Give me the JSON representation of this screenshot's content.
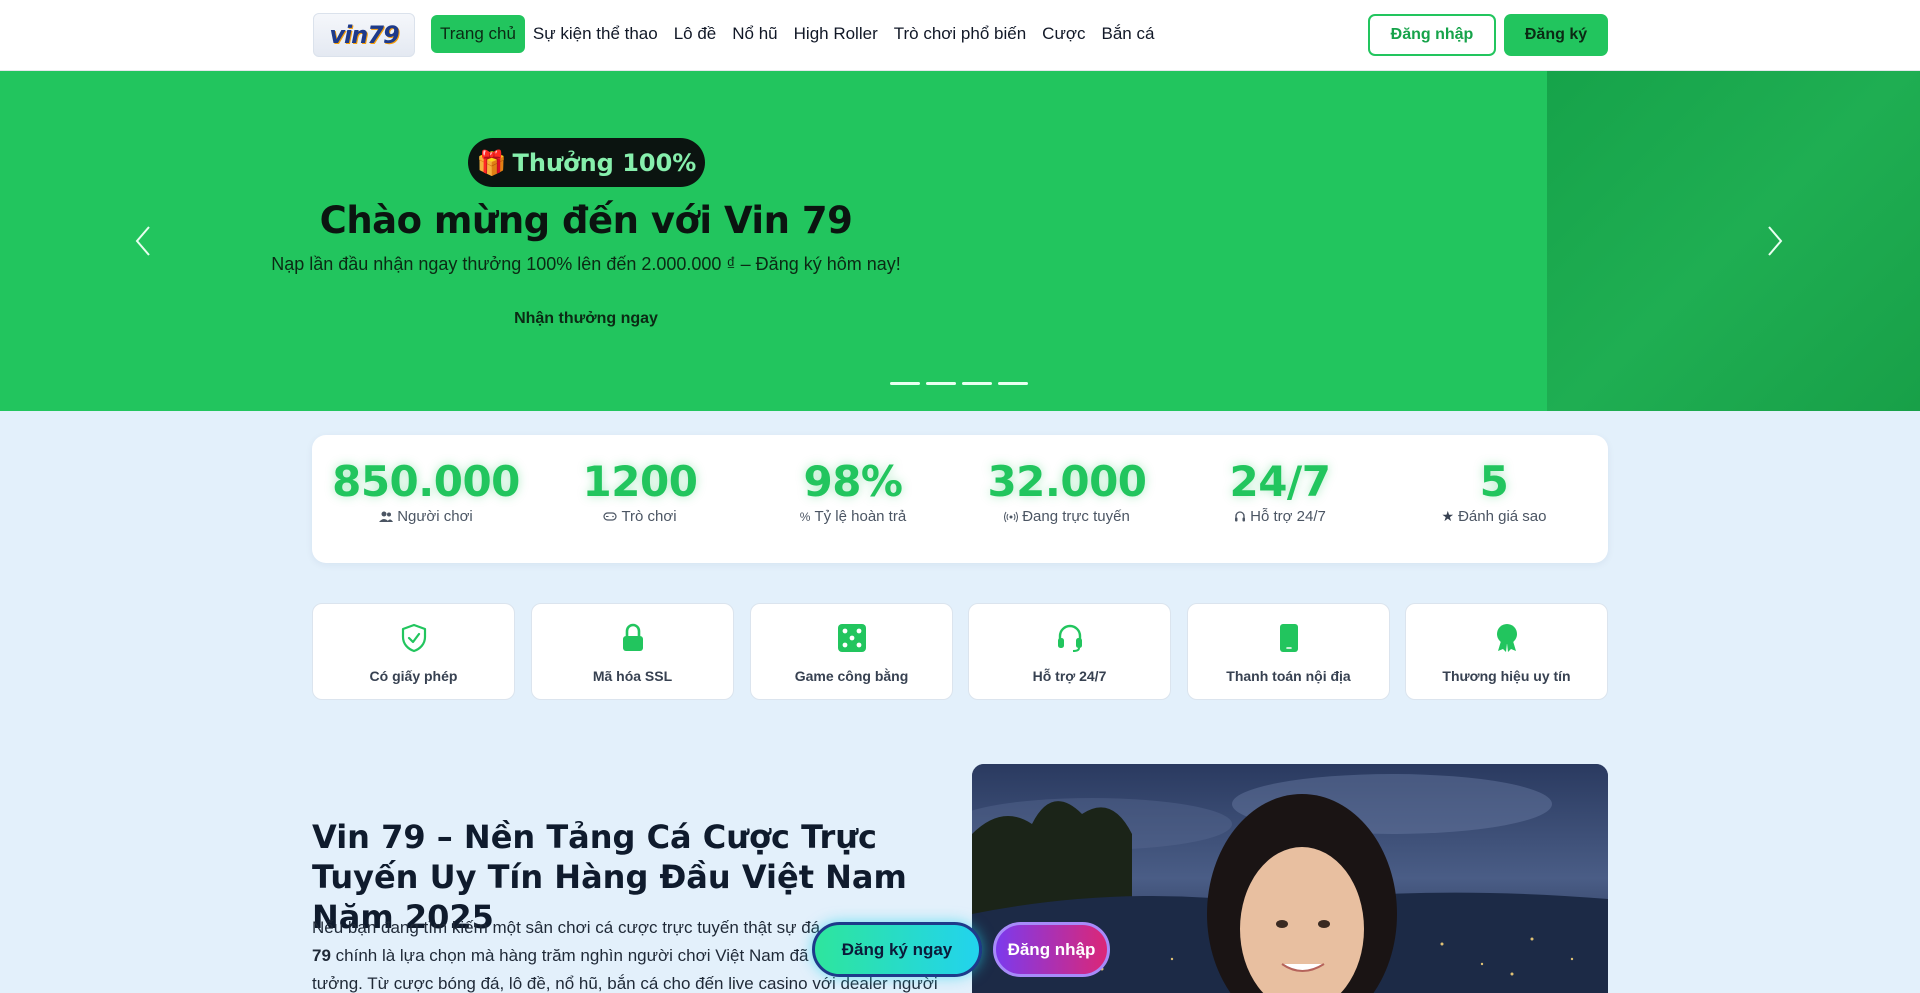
{
  "header": {
    "logo_text": "vin79",
    "nav": [
      {
        "label": "Trang chủ",
        "active": true
      },
      {
        "label": "Sự kiện thể thao"
      },
      {
        "label": "Lô đề"
      },
      {
        "label": "Nổ hũ"
      },
      {
        "label": "High Roller"
      },
      {
        "label": "Trò chơi phổ biến"
      },
      {
        "label": "Cược"
      },
      {
        "label": "Bắn cá"
      }
    ],
    "login_label": "Đăng nhập",
    "register_label": "Đăng ký"
  },
  "hero": {
    "badge_icon": "gift-icon",
    "badge_text": "Thưởng 100%",
    "title": "Chào mừng đến với Vin 79",
    "subtitle": "Nạp lần đầu nhận ngay thưởng 100% lên đến 2.000.000 ₫ – Đăng ký hôm nay!",
    "cta_label": "Nhận thưởng ngay",
    "slide_count": 4,
    "accent": "#22c55e"
  },
  "stats": [
    {
      "value": "850.000",
      "label": "Người chơi",
      "icon": "users-icon"
    },
    {
      "value": "1200",
      "label": "Trò chơi",
      "icon": "gamepad-icon"
    },
    {
      "value": "98%",
      "label": "Tỷ lệ hoàn trả",
      "icon": "percent-icon"
    },
    {
      "value": "32.000",
      "label": "Đang trực tuyến",
      "icon": "broadcast-icon"
    },
    {
      "value": "24/7",
      "label": "Hỗ trợ 24/7",
      "icon": "headset-icon"
    },
    {
      "value": "5",
      "label": "Đánh giá sao",
      "icon": "star-icon"
    }
  ],
  "features": [
    {
      "label": "Có giấy phép",
      "icon": "shield-check-icon"
    },
    {
      "label": "Mã hóa SSL",
      "icon": "lock-icon"
    },
    {
      "label": "Game công bằng",
      "icon": "dice-icon"
    },
    {
      "label": "Hỗ trợ 24/7",
      "icon": "headset-icon"
    },
    {
      "label": "Thanh toán nội địa",
      "icon": "mobile-icon"
    },
    {
      "label": "Thương hiệu uy tín",
      "icon": "award-icon"
    }
  ],
  "article": {
    "title": "Vin 79 – Nền Tảng Cá Cược Trực Tuyến Uy Tín Hàng Đầu Việt Nam Năm 2025",
    "body_part1": "Nếu bạn đang tìm kiếm một sân chơi cá cược trực tuyến thật sự đá",
    "body_bold": "79",
    "body_part2": " chính là lựa chọn mà hàng trăm nghìn người chơi Việt Nam đã",
    "body_part3": "tưởng. Từ cược bóng đá, lô đề, nổ hũ, bắn cá cho đến live casino với dealer người"
  },
  "floating": {
    "register_label": "Đăng ký ngay",
    "login_label": "Đăng nhập"
  }
}
